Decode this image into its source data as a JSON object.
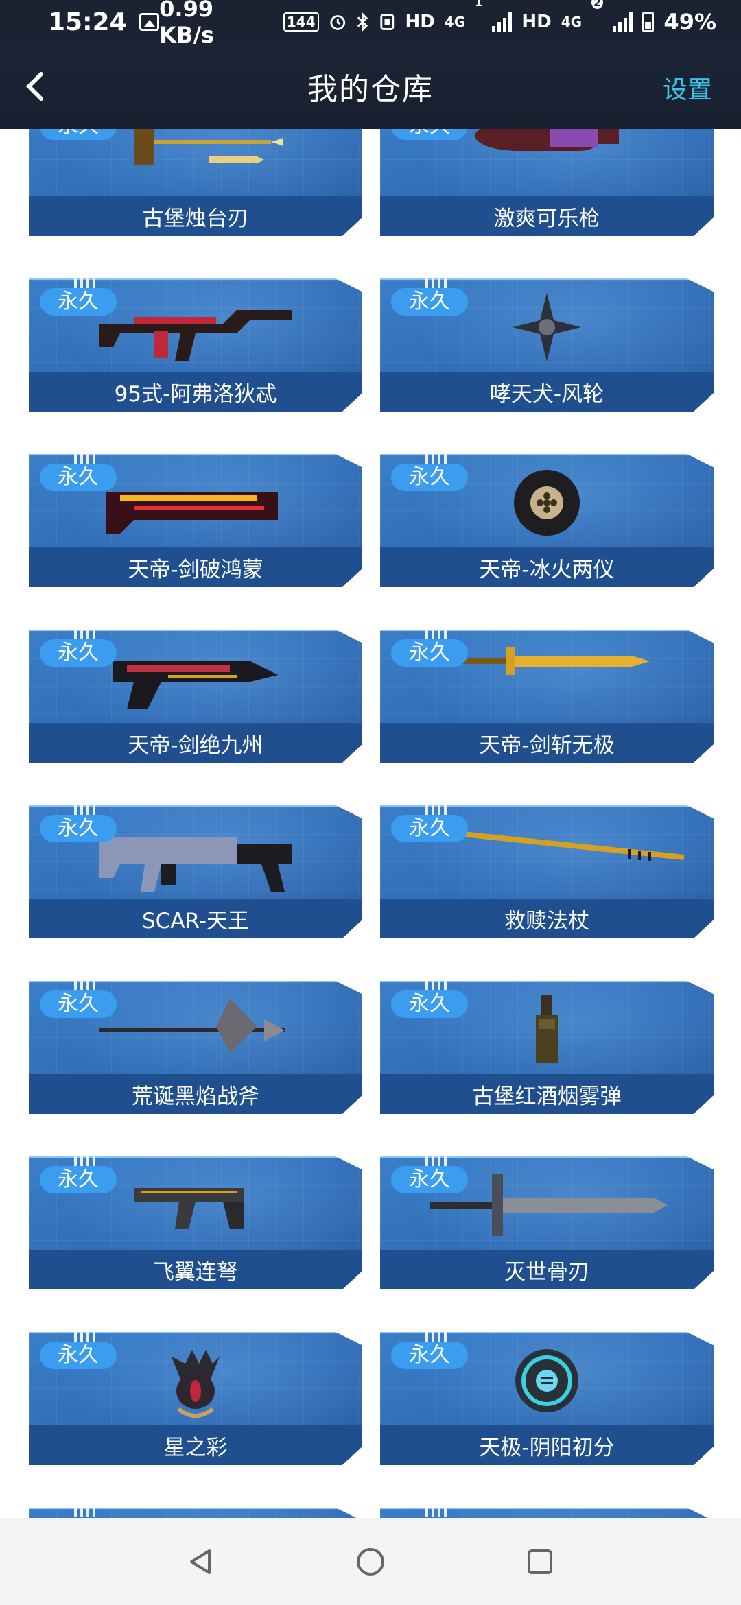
{
  "status_bar": {
    "time": "15:24",
    "speed": "0.99 KB/s",
    "refresh": "144",
    "hd1": "HD",
    "net1": "4G",
    "sim1": "1",
    "hd2": "HD",
    "net2": "4G",
    "sim2": "2",
    "battery": "49%"
  },
  "nav": {
    "title": "我的仓库",
    "settings": "设置"
  },
  "badge_text": "永久",
  "items": [
    {
      "name": "古堡烛台刃",
      "icon": "candelabra-blade-icon"
    },
    {
      "name": "激爽可乐枪",
      "icon": "cola-gun-icon"
    },
    {
      "name": "95式-阿弗洛狄忒",
      "icon": "rifle-icon"
    },
    {
      "name": "哮天犬-风轮",
      "icon": "shuriken-icon"
    },
    {
      "name": "天帝-剑破鸿蒙",
      "icon": "heavy-gun-icon"
    },
    {
      "name": "天帝-冰火两仪",
      "icon": "grenade-ball-icon"
    },
    {
      "name": "天帝-剑绝九州",
      "icon": "blaster-icon"
    },
    {
      "name": "天帝-剑斩无极",
      "icon": "golden-sword-icon"
    },
    {
      "name": "SCAR-天王",
      "icon": "scar-rifle-icon"
    },
    {
      "name": "救赎法杖",
      "icon": "staff-icon"
    },
    {
      "name": "荒诞黑焰战斧",
      "icon": "battle-axe-icon"
    },
    {
      "name": "古堡红酒烟雾弹",
      "icon": "wine-bottle-icon"
    },
    {
      "name": "飞翼连弩",
      "icon": "crossbow-icon"
    },
    {
      "name": "灭世骨刃",
      "icon": "bone-blade-icon"
    },
    {
      "name": "星之彩",
      "icon": "claw-icon"
    },
    {
      "name": "天极-阴阳初分",
      "icon": "orb-grenade-icon"
    }
  ]
}
